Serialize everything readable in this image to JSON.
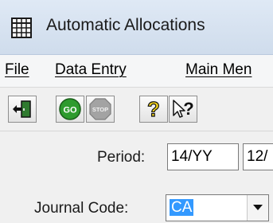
{
  "window": {
    "title": "Automatic Allocations",
    "icon": "grid-table-icon"
  },
  "menu": {
    "items": [
      {
        "label": "File"
      },
      {
        "label": "Data Entry"
      },
      {
        "label": "Main Men"
      }
    ]
  },
  "toolbar": {
    "buttons": [
      {
        "icon": "exit-door-icon"
      },
      {
        "icon": "go-icon",
        "label": "GO",
        "color": "#2e9b2e"
      },
      {
        "icon": "stop-icon",
        "label": "STOP",
        "color": "#9a9a9a"
      },
      {
        "icon": "help-question-icon",
        "color": "#f2d21b"
      },
      {
        "icon": "whats-this-help-icon"
      }
    ]
  },
  "form": {
    "period_label": "Period:",
    "period_value": "14/YY",
    "period_value_2": "12/",
    "journal_code_label": "Journal Code:",
    "journal_code_value": "CA"
  },
  "colors": {
    "selection": "#3399ff",
    "titlebar": "#dfe9f5"
  }
}
